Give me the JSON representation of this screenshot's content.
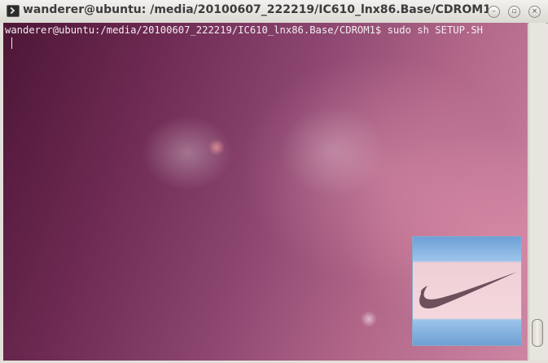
{
  "window": {
    "title": "wanderer@ubuntu: /media/20100607_222219/IC610_lnx86.Base/CDROM1",
    "icon": "terminal-icon",
    "buttons": {
      "minimize": "minimize-icon",
      "maximize": "maximize-icon",
      "close": "close-icon"
    }
  },
  "terminal": {
    "prompt_line": "wanderer@ubuntu:/media/20100607_222219/IC610_lnx86.Base/CDROM1$ sudo sh SETUP.SH"
  },
  "overlay": {
    "image": "nike-swoosh-logo"
  },
  "colors": {
    "terminal_text": "#f3eef0",
    "background_dark": "#4d1636",
    "background_light": "#cc86a3"
  }
}
